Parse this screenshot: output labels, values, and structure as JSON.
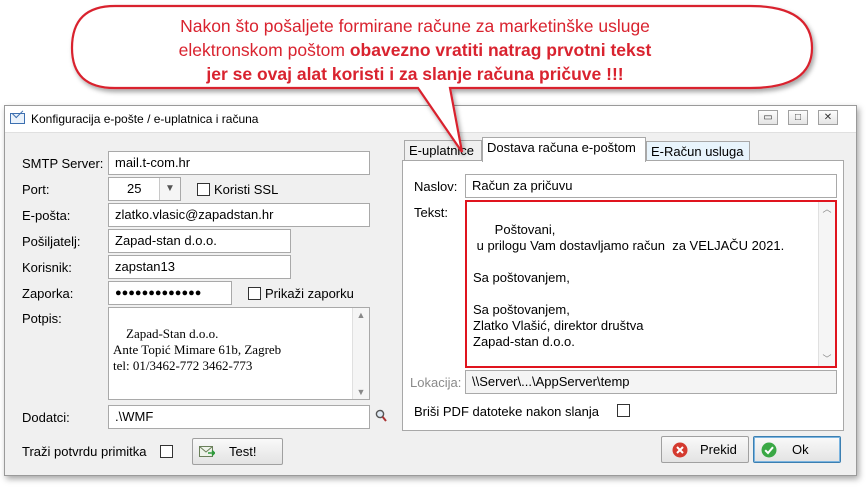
{
  "callout": {
    "line1": "Nakon što pošaljete formirane račune za marketinške usluge",
    "line2_normal": "elektronskom poštom ",
    "line2_bold": "obavezno vratiti natrag prvotni tekst",
    "line3_bold": "jer se ovaj alat koristi i za slanje računa pričuve !!!",
    "color": "#d9232f"
  },
  "window": {
    "title": "Konfiguracija e-pošte / e-uplatnica i računa",
    "minimize": "▭",
    "maximize": "□",
    "close": "✕"
  },
  "left": {
    "smtp_label": "SMTP Server:",
    "smtp_value": "mail.t-com.hr",
    "port_label": "Port:",
    "port_value": "25",
    "ssl_label": "Koristi SSL",
    "email_label": "E-pošta:",
    "email_value": "zlatko.vlasic@zapadstan.hr",
    "sender_label": "Pošiljatelj:",
    "sender_value": "Zapad-stan d.o.o.",
    "user_label": "Korisnik:",
    "user_value": "zapstan13",
    "password_label": "Zaporka:",
    "password_value": "●●●●●●●●●●●●●",
    "show_password_label": "Prikaži zaporku",
    "signature_label": "Potpis:",
    "signature_value": "Zapad-Stan d.o.o.\nAnte Topić Mimare 61b, Zagreb\ntel: 01/3462-772 3462-773",
    "attachments_label": "Dodatci:",
    "attachments_value": ".\\WMF",
    "receipt_label": "Traži potvrdu primitka",
    "test_button": "Test!"
  },
  "tabs": [
    {
      "label": "E-uplatnice"
    },
    {
      "label": "Dostava računa e-poštom"
    },
    {
      "label": "E-Račun usluga"
    }
  ],
  "right": {
    "subject_label": "Naslov:",
    "subject_value": "Račun za pričuvu",
    "text_label": "Tekst:",
    "text_value": "Poštovani,\n u prilogu Vam dostavljamo račun  za VELJAČU 2021.\n\nSa poštovanjem,\n\nSa poštovanjem,\nZlatko Vlašić, direktor društva\nZapad-stan d.o.o.",
    "location_label": "Lokacija:",
    "location_value": "\\\\Server\\...\\AppServer\\temp",
    "delete_pdf_label": "Briši PDF datoteke nakon slanja"
  },
  "buttons": {
    "cancel": "Prekid",
    "ok": "Ok"
  },
  "colors": {
    "highlight_border": "#e0141e",
    "cancel_icon": "#d43a2f",
    "ok_icon": "#3aa845"
  }
}
